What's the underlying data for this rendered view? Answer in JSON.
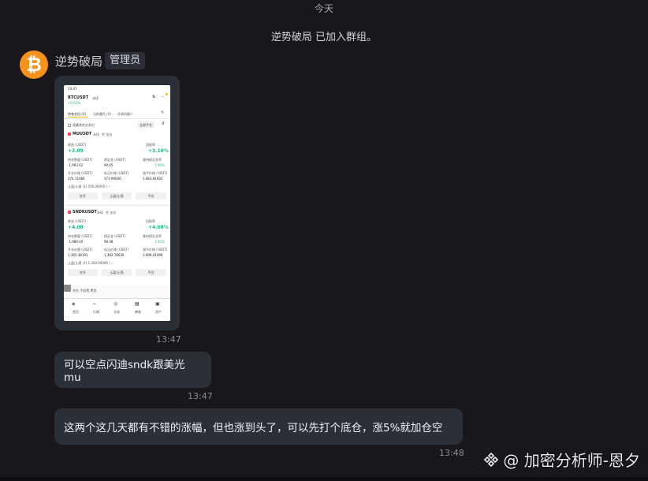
{
  "chat": {
    "date_separator": "今天",
    "system_message": "逆势破局 已加入群组。",
    "sender": {
      "name": "逆势破局",
      "role": "管理员",
      "avatar_glyph": "₿",
      "avatar_color": "#f7931a"
    },
    "messages": [
      {
        "type": "image",
        "time": "13:47"
      },
      {
        "type": "text",
        "text": "可以空点闪迪sndk跟美光mu",
        "time": "13:47"
      },
      {
        "type": "text",
        "text": "这两个这几天都有不错的涨幅，但也涨到头了，可以先打个底仓，涨5%就加仓空",
        "time": "13:48"
      }
    ]
  },
  "screenshot": {
    "status_time": "13:47",
    "symbol": "BTCUSDT",
    "symbol_suffix": "永续",
    "symbol_change": "+0.02%",
    "tabs": [
      "持有仓位 (2)",
      "当前委托 (0)",
      "交易机器人"
    ],
    "filter_label": "隐藏其他交易对",
    "filter_button": "全部平仓",
    "positions": [
      {
        "name": "MUUSDT",
        "tag1": "永续",
        "tag2": "空 全仓",
        "pnl_label": "收益 (USDT)",
        "pnl": "+3.09",
        "roi_label": "回报率",
        "roi": "+3.10%",
        "size_label": "持仓数量 (USDT)",
        "size": "-1,993.02",
        "margin_label": "保证金 (USDT)",
        "margin": "99.65",
        "ratio_label": "维持保证金率",
        "ratio": "1.06%",
        "entry_label": "开仓价格 (USDT)",
        "entry": "374.11084",
        "mark_label": "标记价格 (USDT)",
        "mark": "373.99000",
        "liq_label": "强平价格 (USDT)",
        "liq": "1,963.81002",
        "tpsl": "止盈/止损 (1) 500.00000 / --",
        "buttons": [
          "杠杆",
          "止盈/止损",
          "平仓"
        ]
      },
      {
        "name": "SNDKUSDT",
        "tag1": "永续",
        "tag2": "空 全仓",
        "pnl_label": "收益 (USDT)",
        "pnl": "+4.08",
        "roi_label": "回报率",
        "roi": "+4.08%",
        "size_label": "持仓数量 (USDT)",
        "size": "-1,989.40",
        "margin_label": "保证金 (USDT)",
        "margin": "99.48",
        "ratio_label": "维持保证金率",
        "ratio": "1.05%",
        "entry_label": "开仓价格 (USDT)",
        "entry": "1,365.38191",
        "mark_label": "标记价格 (USDT)",
        "mark": "1,362.78639",
        "liq_label": "强平价格 (USDT)",
        "liq": "3,999.41090",
        "tpsl": "止盈/止损 (1) 1,300.00000 / --",
        "buttons": [
          "杠杆",
          "止盈/止损",
          "平仓"
        ]
      }
    ],
    "footer_text": "合约 手续费 费用",
    "bottom_nav": [
      "首页",
      "行情",
      "交易",
      "持仓",
      "资产"
    ]
  },
  "watermark": {
    "text": "@ 加密分析师-恩夕",
    "icon": "binance-diamond-icon"
  }
}
